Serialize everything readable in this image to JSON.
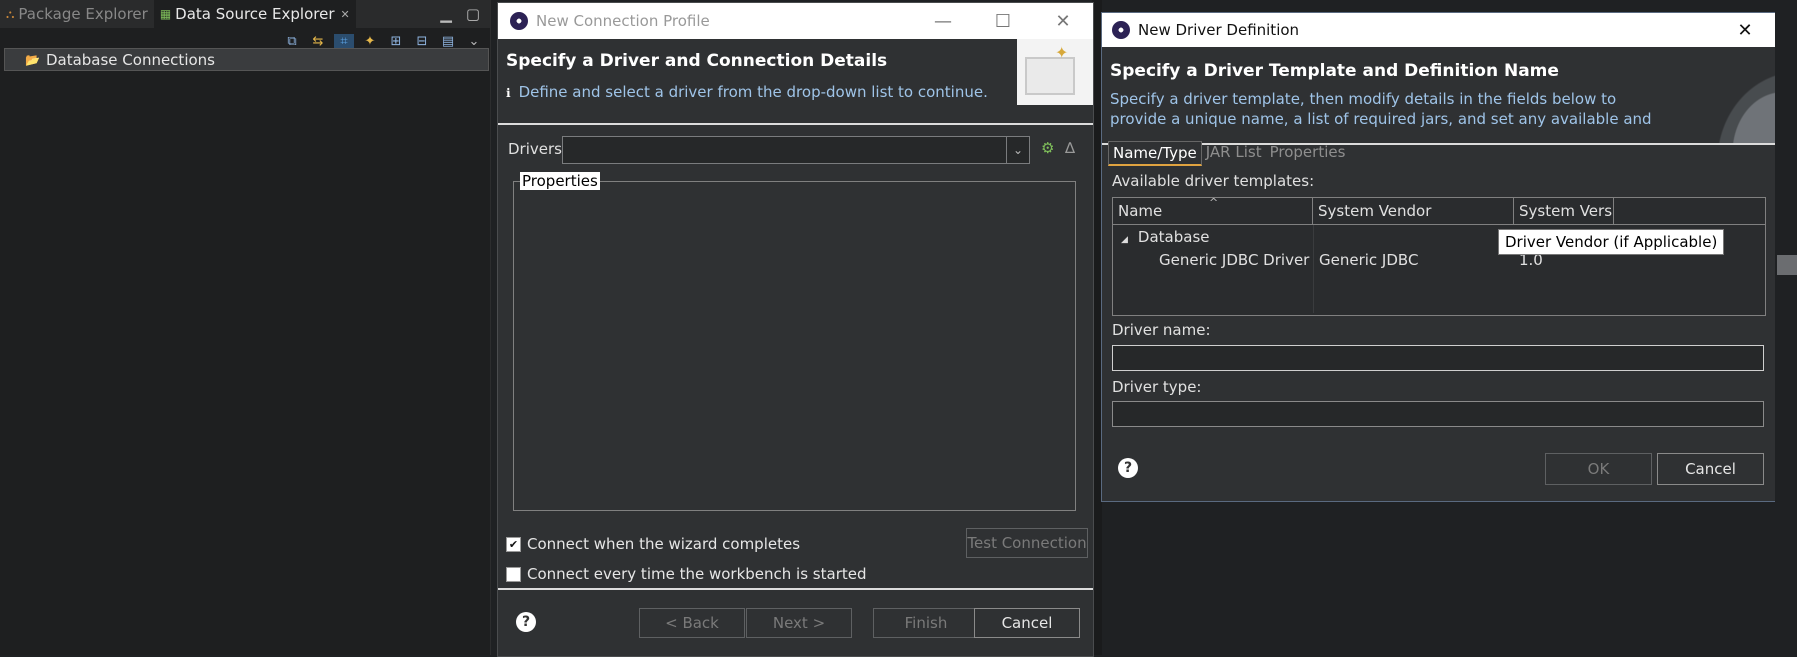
{
  "explorer": {
    "tabs": [
      {
        "label": "Package Explorer",
        "active": false
      },
      {
        "label": "Data Source Explorer",
        "active": true
      }
    ],
    "tree": {
      "item": "Database Connections"
    }
  },
  "dialog1": {
    "title": "New Connection Profile",
    "heading": "Specify a Driver and Connection Details",
    "description": "Define and select a driver from the drop-down list to continue.",
    "drivers_label": "Drivers:",
    "drivers_value": "",
    "properties_group": "Properties",
    "connect_on_complete": {
      "label": "Connect when the wizard completes",
      "checked": true
    },
    "connect_every_time": {
      "label": "Connect every time the workbench is started",
      "checked": false
    },
    "test_connection": "Test Connection",
    "buttons": {
      "back": "< Back",
      "next": "Next >",
      "finish": "Finish",
      "cancel": "Cancel"
    }
  },
  "dialog2": {
    "title": "New Driver Definition",
    "heading": "Specify a Driver Template and Definition Name",
    "description": "Specify a driver template, then modify details in the fields below to provide a unique name, a list of required jars, and set any available and applicable property",
    "tabs": [
      "Name/Type",
      "JAR List",
      "Properties"
    ],
    "available_label": "Available driver templates:",
    "columns": [
      "Name",
      "System Vendor",
      "System Versio"
    ],
    "rows": [
      {
        "name": "Database",
        "vendor": "",
        "version": "",
        "category": true
      },
      {
        "name": "Generic JDBC Driver",
        "vendor": "Generic JDBC",
        "version": "1.0",
        "category": false
      }
    ],
    "tooltip": "Driver Vendor (if Applicable)",
    "driver_name_label": "Driver name:",
    "driver_name_value": "",
    "driver_type_label": "Driver type:",
    "driver_type_value": "",
    "buttons": {
      "ok": "OK",
      "cancel": "Cancel"
    }
  },
  "colors": {
    "accent": "#e0a340",
    "description": "#9fc4e8",
    "dialog_bg": "#2f3133"
  }
}
